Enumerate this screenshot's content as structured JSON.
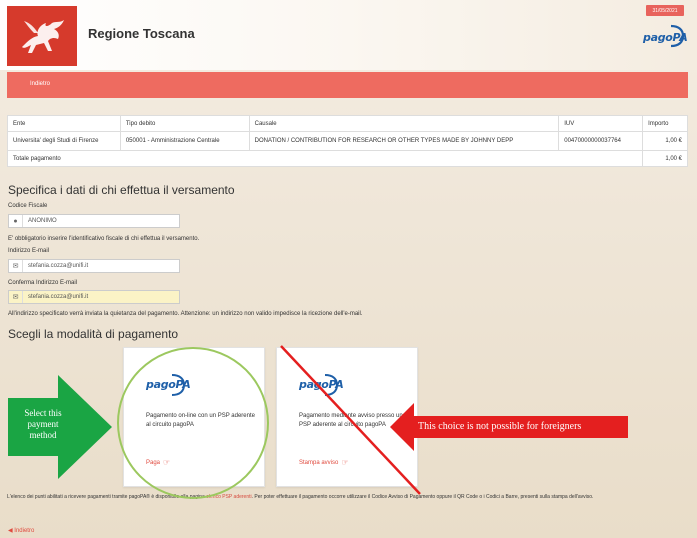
{
  "header": {
    "brand_title": "Regione Toscana",
    "date": "31/05/2021",
    "pagopa_logo": "pagoPA"
  },
  "nav": {
    "back_label": "Indietro"
  },
  "table": {
    "columns": [
      "Ente",
      "Tipo debito",
      "Causale",
      "IUV",
      "Importo"
    ],
    "rows": [
      {
        "ente": "Universita' degli Studi di Firenze",
        "tipo_debito": "050001 - Amministrazione Centrale",
        "causale": "DONATION / CONTRIBUTION FOR RESEARCH OR OTHER TYPES MADE BY JOHNNY DEPP",
        "iuv": "00470000000037764",
        "importo": "1,00 €"
      }
    ],
    "total_label": "Totale pagamento",
    "total_value": "1,00 €"
  },
  "payer": {
    "section_title": "Specifica i dati di chi effettua il versamento",
    "fiscal_code_label": "Codice Fiscale",
    "fiscal_code_value": "ANONIMO",
    "fiscal_code_note": "E' obbligatorio inserire l'identificativo fiscale di chi effettua il versamento.",
    "email_label": "Indirizzo E-mail",
    "email_value": "stefania.cozza@unifi.it",
    "confirm_email_label": "Conferma Indirizzo E-mail",
    "confirm_email_value": "stefania.cozza@unifi.it",
    "email_note": "All'indirizzo specificato verrà inviata la quietanza del pagamento. Attenzione: un indirizzo non valido impedisce la ricezione dell'e-mail."
  },
  "payment_method": {
    "section_title": "Scegli la modalità di pagamento",
    "options": [
      {
        "logo": "pagoPA",
        "description": "Pagamento on-line con un PSP aderente al circuito pagoPA",
        "action": "Paga"
      },
      {
        "logo": "pagoPA",
        "description": "Pagamento mediante avviso presso un PSP aderente al circuito pagoPA",
        "action": "Stampa avviso"
      }
    ]
  },
  "footer": {
    "text_before_link": "L'elenco dei punti abilitati a ricevere pagamenti tramite pagoPA® è disponibile alla pagina ",
    "link_label": "elenco PSP aderenti",
    "text_after_link": ". Per poter effettuare il pagamento occorre utilizzare il Codice Avviso di Pagamento oppure il QR Code o i Codici a Barre, presenti sulla stampa dell'avviso.",
    "back_label": "Indietro"
  },
  "annotations": {
    "green_arrow_text": "Select this payment method",
    "red_arrow_text": "This choice is not possible for foreigners"
  },
  "colors": {
    "brand_red": "#ee6b60",
    "pagopa_blue": "#1e5fa8",
    "annotation_green": "#1aa544",
    "annotation_red": "#e41f1f",
    "circle_green": "#9cc85f"
  }
}
